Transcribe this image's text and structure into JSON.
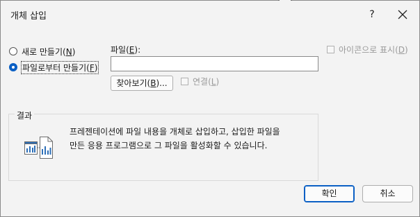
{
  "dialog": {
    "title": "개체 삽입",
    "help_label": "?"
  },
  "options": {
    "create_new_label": "새로 만들기",
    "create_new_key": "N",
    "create_from_file_label": "파일로부터 만들기",
    "create_from_file_key": "F",
    "selected": "create_from_file"
  },
  "file": {
    "label": "파일",
    "key": "E",
    "label_suffix": ":",
    "value": "",
    "browse_label": "찾아보기",
    "browse_key": "B",
    "browse_suffix": "...",
    "link_label": "연결",
    "link_key": "L",
    "link_checked": false
  },
  "display_as_icon": {
    "label": "아이콘으로 표시",
    "key": "D",
    "checked": false
  },
  "result": {
    "title": "결과",
    "description_line1": "프레젠테이션에 파일 내용을 개체로 삽입하고, 삽입한 파일을",
    "description_line2": "만든 응용 프로그램으로 그 파일을 활성화할 수 있습니다."
  },
  "buttons": {
    "ok": "확인",
    "cancel": "취소"
  },
  "colors": {
    "accent": "#0a5fc4",
    "dialog_bg": "#f3f3f3",
    "disabled_text": "#9a9a9a"
  }
}
